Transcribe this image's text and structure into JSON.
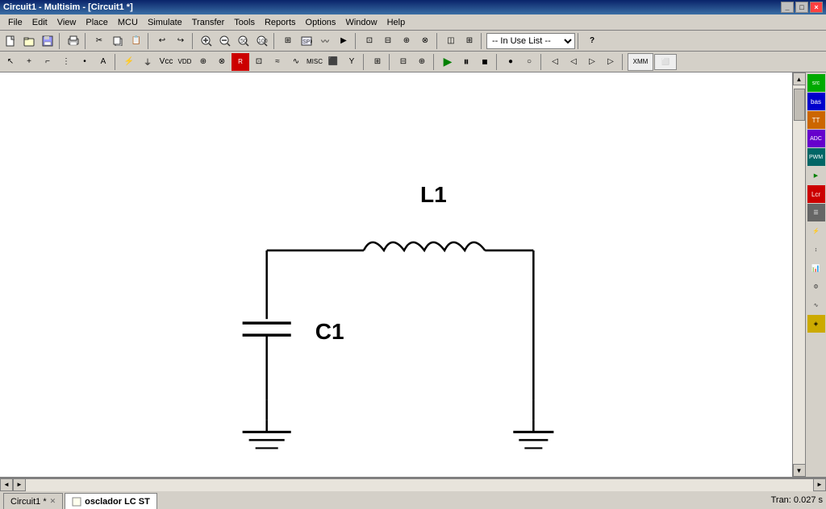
{
  "titleBar": {
    "title": "Circuit1 - Multisim - [Circuit1 *]",
    "controls": [
      "_",
      "□",
      "×"
    ]
  },
  "menuBar": {
    "items": [
      "File",
      "Edit",
      "View",
      "Place",
      "MCU",
      "Simulate",
      "Transfer",
      "Tools",
      "Reports",
      "Options",
      "Window",
      "Help"
    ]
  },
  "toolbar1": {
    "inUseList": "-- In Use List --",
    "helpBtn": "?"
  },
  "circuit": {
    "L1_label": "L1",
    "C1_label": "C1"
  },
  "statusBar": {
    "tabs": [
      {
        "label": "Circuit1 *",
        "hasClose": true,
        "active": false
      },
      {
        "label": "osclador LC ST",
        "hasClose": false,
        "active": true
      }
    ],
    "statusText": "Tran: 0.027 s",
    "navLeft": "◄",
    "navRight": "►"
  },
  "rightPanel": {
    "buttons": [
      "src",
      "bas",
      "TT",
      "ADC",
      "PWM",
      "▶",
      "Lcr",
      "☰",
      "⚡",
      "↕",
      "📊",
      "⚙",
      "∿",
      "◈"
    ]
  }
}
